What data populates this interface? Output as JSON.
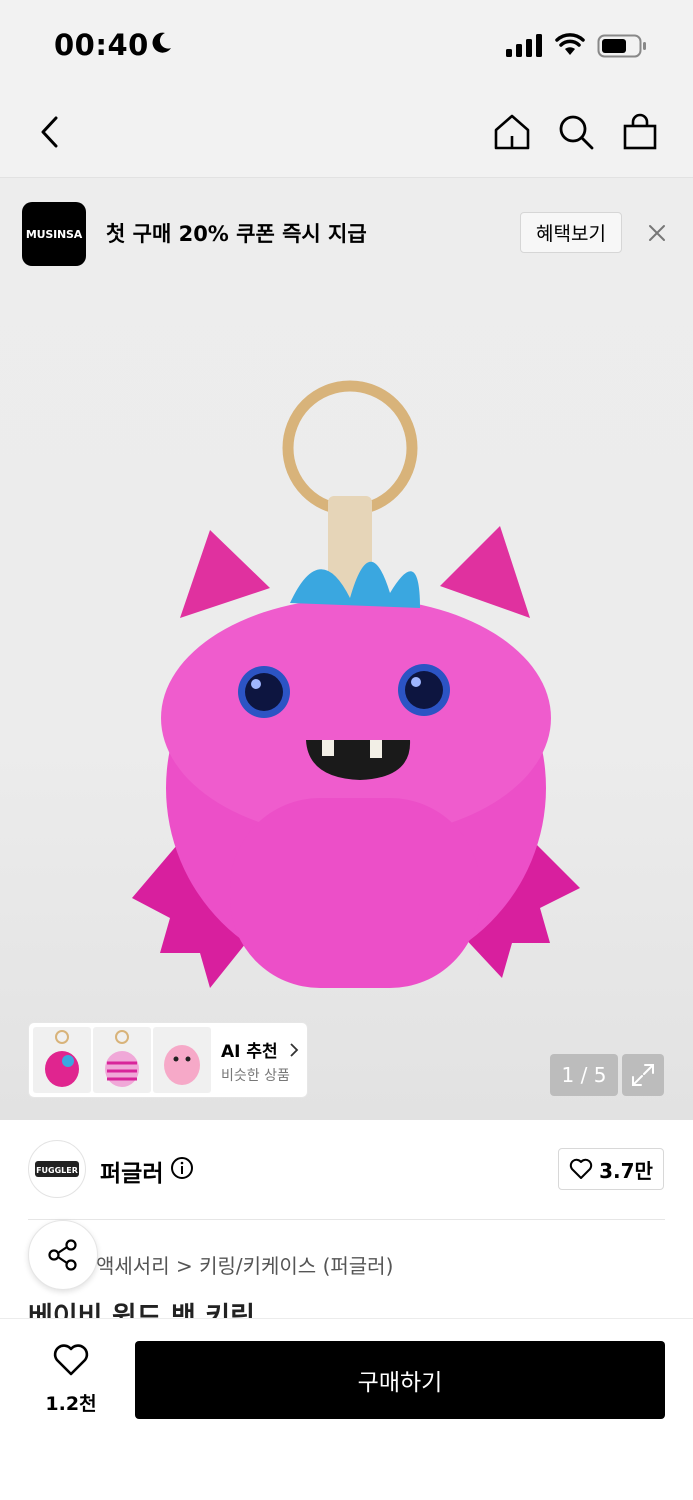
{
  "status_bar": {
    "time": "00:40"
  },
  "promo": {
    "logo_text": "MUSINSA",
    "text": "첫 구매 20% 쿠폰 즉시 지급",
    "button_label": "혜택보기"
  },
  "gallery": {
    "ai_reco_title": "AI 추천",
    "ai_reco_subtitle": "비슷한 상품",
    "pager": "1 / 5"
  },
  "brand": {
    "name": "퍼글러",
    "logo_text": "FUGGLER",
    "like_count": "3.7만"
  },
  "breadcrumb": "액세서리 > 키링/키케이스 (퍼글러)",
  "product_title": "베이비 윙드 뱃 키링",
  "bottom_bar": {
    "wish_count": "1.2천",
    "buy_label": "구매하기"
  },
  "colors": {
    "accent": "#000000",
    "product_pink": "#e73fc0",
    "product_blue": "#3aa7e0"
  }
}
